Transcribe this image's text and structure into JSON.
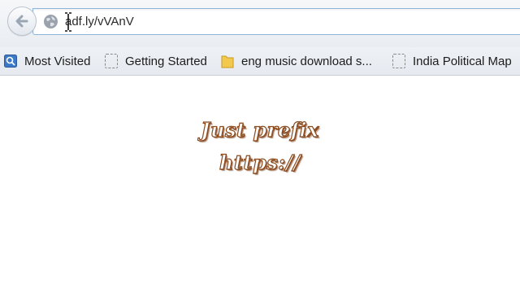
{
  "browser": {
    "address_bar": {
      "url": "adf.ly/vVAnV"
    },
    "bookmarks": [
      {
        "label": "Most Visited",
        "icon": "most-visited-icon"
      },
      {
        "label": "Getting Started",
        "icon": "blank-page-icon"
      },
      {
        "label": "eng music download s...",
        "icon": "folder-icon"
      },
      {
        "label": "India Political Map",
        "icon": "blank-page-icon"
      }
    ]
  },
  "page": {
    "caption_line1": "Just prefix",
    "caption_line2": "https://"
  },
  "colors": {
    "url_border": "#8eb4de",
    "caption_outline": "#8a4a1c",
    "folder": "#f2c94c"
  }
}
